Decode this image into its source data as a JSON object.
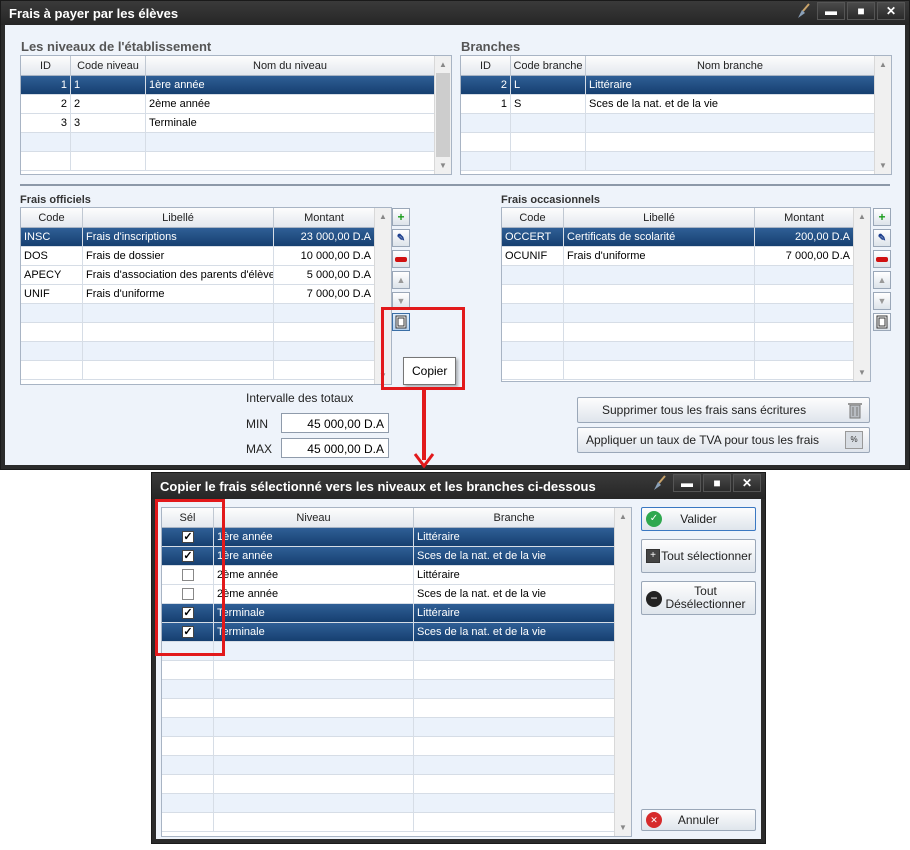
{
  "main_window": {
    "title": "Frais à payer par les élèves",
    "controls": {
      "minimize": "▬",
      "maximize": "■",
      "close": "✕"
    },
    "niveaux": {
      "section_title": "Les niveaux de l'établissement",
      "headers": [
        "ID",
        "Code niveau",
        "Nom du niveau"
      ],
      "rows": [
        {
          "id": "1",
          "code": "1",
          "nom": "1ère année"
        },
        {
          "id": "2",
          "code": "2",
          "nom": "2ème année"
        },
        {
          "id": "3",
          "code": "3",
          "nom": "Terminale"
        }
      ]
    },
    "branches": {
      "section_title": "Branches",
      "headers": [
        "ID",
        "Code branche",
        "Nom branche"
      ],
      "rows": [
        {
          "id": "2",
          "code": "L",
          "nom": "Littéraire"
        },
        {
          "id": "1",
          "code": "S",
          "nom": "Sces de la nat. et de la vie"
        }
      ]
    },
    "frais_officiels": {
      "section_title": "Frais officiels",
      "headers": [
        "Code",
        "Libellé",
        "Montant"
      ],
      "rows": [
        {
          "code": "INSC",
          "libelle": "Frais d'inscriptions",
          "montant": "23 000,00 D.A"
        },
        {
          "code": "DOS",
          "libelle": "Frais de dossier",
          "montant": "10 000,00 D.A"
        },
        {
          "code": "APECY",
          "libelle": "Frais d'association des parents d'élèves",
          "montant": "5 000,00 D.A"
        },
        {
          "code": "UNIF",
          "libelle": "Frais d'uniforme",
          "montant": "7 000,00 D.A"
        }
      ]
    },
    "frais_occasionnels": {
      "section_title": "Frais occasionnels",
      "headers": [
        "Code",
        "Libellé",
        "Montant"
      ],
      "rows": [
        {
          "code": "OCCERT",
          "libelle": "Certificats de scolarité",
          "montant": "200,00 D.A"
        },
        {
          "code": "OCUNIF",
          "libelle": "Frais d'uniforme",
          "montant": "7 000,00 D.A"
        }
      ]
    },
    "totaux": {
      "label": "Intervalle des totaux",
      "min_label": "MIN",
      "min_value": "45 000,00 D.A",
      "max_label": "MAX",
      "max_value": "45 000,00 D.A"
    },
    "buttons": {
      "supprimer": "Supprimer tous les frais sans écritures",
      "appliquer": "Appliquer un taux de TVA pour tous les frais"
    },
    "tooltip": "Copier"
  },
  "copy_dialog": {
    "title": "Copier le frais sélectionné vers les niveaux et les branches ci-dessous",
    "controls": {
      "minimize": "▬",
      "maximize": "■",
      "close": "✕"
    },
    "headers": [
      "Sél",
      "Niveau",
      "Branche"
    ],
    "rows": [
      {
        "checked": true,
        "niveau": "1ère année",
        "branche": "Littéraire"
      },
      {
        "checked": true,
        "niveau": "1ère année",
        "branche": "Sces de la nat. et de la vie"
      },
      {
        "checked": false,
        "niveau": "2ème année",
        "branche": "Littéraire"
      },
      {
        "checked": false,
        "niveau": "2ème année",
        "branche": "Sces de la nat. et de la vie"
      },
      {
        "checked": true,
        "niveau": "Terminale",
        "branche": "Littéraire"
      },
      {
        "checked": true,
        "niveau": "Terminale",
        "branche": "Sces de la nat. et de la vie"
      }
    ],
    "buttons": {
      "valider": "Valider",
      "tout_selectionner": "Tout sélectionner",
      "tout_deselectionner_1": "Tout",
      "tout_deselectionner_2": "Désélectionner",
      "annuler": "Annuler"
    }
  },
  "colors": {
    "selection": "#1f4f86",
    "highlight": "#e2191b",
    "window": "#2b2b2b"
  }
}
